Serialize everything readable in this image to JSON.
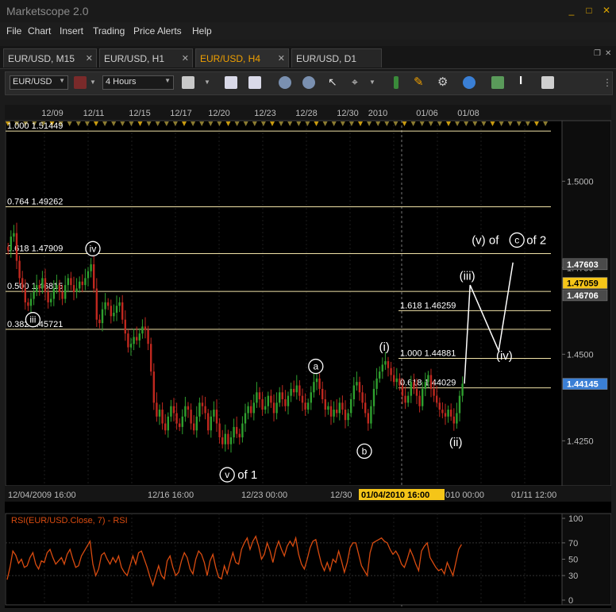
{
  "app": {
    "title": "Marketscope 2.0"
  },
  "window_controls": {
    "min": "_",
    "max": "□",
    "close": "✕"
  },
  "menu": [
    "File",
    "Chart",
    "Insert",
    "Trading",
    "Price Alerts",
    "Help"
  ],
  "tabs": [
    {
      "label": "EUR/USD, M15",
      "active": false
    },
    {
      "label": "EUR/USD, H1",
      "active": false
    },
    {
      "label": "EUR/USD, H4",
      "active": true
    },
    {
      "label": "EUR/USD, D1",
      "active": false
    }
  ],
  "toolbar": {
    "instrument": "EUR/USD",
    "timeframe": "4 Hours",
    "icons": [
      "link-icon",
      "bar-style-icon",
      "data-window-icon",
      "stats-icon",
      "zoom-in-icon",
      "zoom-out-icon",
      "cursor-icon",
      "crosshair-icon",
      "trendline-icon",
      "pencil-icon",
      "gear-icon",
      "globe-icon",
      "indicator-icon",
      "text-icon",
      "table-icon"
    ]
  },
  "colors": {
    "bg": "#000000",
    "panel": "#1b1b1b",
    "up": "#2fa02f",
    "down": "#c0281f",
    "fib": "#f1e3a8",
    "accent": "#f0a000",
    "rsi": "#d84b10",
    "current": "#f5c518",
    "highlight": "#3a7fd5"
  },
  "chart_data": [
    {
      "type": "candlestick",
      "instrument": "EUR/USD",
      "timeframe": "H4",
      "x_date_labels": [
        "12/09",
        "12/11",
        "12/15",
        "12/17",
        "12/20",
        "12/23",
        "12/28",
        "12/30",
        "2010",
        "01/06",
        "01/08"
      ],
      "x_time_labels": [
        "12/04/2009 16:00",
        "12/16 16:00",
        "12/23 00:00",
        "12/30",
        "01/04/2010 16:00",
        "010 00:00",
        "01/11 12:00"
      ],
      "y_ticks": [
        "1.5000",
        "1.4750",
        "1.4500",
        "1.4250"
      ],
      "ylim": [
        1.412,
        1.5175
      ],
      "price_tags": [
        {
          "value": "1.47603",
          "style": "gray"
        },
        {
          "value": "1.47059",
          "style": "current"
        },
        {
          "value": "1.46706",
          "style": "gray"
        },
        {
          "value": "1.44145",
          "style": "highlight"
        }
      ],
      "fib_levels": [
        {
          "label": "1.000 1.51449",
          "price": 1.51449
        },
        {
          "label": "0.764 1.49262",
          "price": 1.49262
        },
        {
          "label": "0.618 1.47909",
          "price": 1.47909
        },
        {
          "label": "0.500 1.46815",
          "price": 1.46815
        },
        {
          "label": "0.382 1.45721",
          "price": 1.45721
        }
      ],
      "ext_levels": [
        {
          "label": "1.618 1.46259",
          "price": 1.46259
        },
        {
          "label": "1.000 1.44881",
          "price": 1.44881
        },
        {
          "label": "0.618 1.44029",
          "price": 1.44029
        }
      ],
      "wave_labels": [
        {
          "circled": "iv",
          "text": "",
          "idx": 30,
          "price": 1.4805
        },
        {
          "circled": "iii",
          "text": "",
          "idx": 9,
          "price": 1.46
        },
        {
          "circled": "v",
          "text": "of 1",
          "idx": 77,
          "price": 1.4152
        },
        {
          "circled": "a",
          "text": "",
          "idx": 108,
          "price": 1.4465
        },
        {
          "circled": "b",
          "text": "",
          "idx": 125,
          "price": 1.422
        },
        {
          "circled": "",
          "text": "(i)",
          "idx": 132,
          "price": 1.451
        },
        {
          "circled": "",
          "text": "(ii)",
          "idx": 157,
          "price": 1.4235
        },
        {
          "circled": "",
          "text": "(iii)",
          "idx": 161,
          "price": 1.4715
        },
        {
          "circled": "",
          "text": "(iv)",
          "idx": 174,
          "price": 1.4485
        },
        {
          "circled": "",
          "text": "(v) of",
          "circled2": "c",
          "text2": "of 2",
          "idx": 177,
          "price": 1.483
        }
      ],
      "projection": [
        [
          160,
          1.4415
        ],
        [
          162,
          1.47
        ],
        [
          172,
          1.451
        ],
        [
          177,
          1.4765
        ]
      ],
      "close": [
        1.48,
        1.484,
        1.485,
        1.477,
        1.472,
        1.469,
        1.465,
        1.464,
        1.466,
        1.468,
        1.47,
        1.469,
        1.472,
        1.468,
        1.465,
        1.466,
        1.469,
        1.47,
        1.468,
        1.466,
        1.47,
        1.472,
        1.47,
        1.468,
        1.469,
        1.471,
        1.47,
        1.472,
        1.474,
        1.476,
        1.469,
        1.46,
        1.459,
        1.463,
        1.465,
        1.464,
        1.461,
        1.462,
        1.464,
        1.465,
        1.46,
        1.456,
        1.452,
        1.453,
        1.455,
        1.454,
        1.456,
        1.458,
        1.457,
        1.453,
        1.445,
        1.436,
        1.432,
        1.434,
        1.43,
        1.428,
        1.432,
        1.435,
        1.433,
        1.43,
        1.429,
        1.432,
        1.435,
        1.434,
        1.43,
        1.428,
        1.432,
        1.436,
        1.435,
        1.433,
        1.428,
        1.432,
        1.434,
        1.43,
        1.426,
        1.424,
        1.427,
        1.424,
        1.426,
        1.429,
        1.427,
        1.426,
        1.43,
        1.433,
        1.435,
        1.433,
        1.436,
        1.439,
        1.437,
        1.434,
        1.435,
        1.438,
        1.436,
        1.433,
        1.436,
        1.439,
        1.437,
        1.435,
        1.438,
        1.44,
        1.439,
        1.441,
        1.438,
        1.436,
        1.434,
        1.436,
        1.439,
        1.442,
        1.443,
        1.44,
        1.437,
        1.434,
        1.435,
        1.432,
        1.434,
        1.433,
        1.436,
        1.434,
        1.431,
        1.433,
        1.437,
        1.441,
        1.442,
        1.439,
        1.436,
        1.433,
        1.43,
        1.435,
        1.44,
        1.443,
        1.445,
        1.447,
        1.448,
        1.446,
        1.444,
        1.442,
        1.443,
        1.441,
        1.438,
        1.436,
        1.438,
        1.442,
        1.44,
        1.438,
        1.435,
        1.44,
        1.442,
        1.444,
        1.44,
        1.438,
        1.436,
        1.434,
        1.433,
        1.432,
        1.434,
        1.432,
        1.43,
        1.433,
        1.438,
        1.4415
      ]
    },
    {
      "type": "line",
      "title": "RSI(EUR/USD.Close, 7) - RSI",
      "y_ticks": [
        "100",
        "70",
        "50",
        "30",
        "0"
      ],
      "ylim": [
        0,
        100
      ],
      "levels": [
        30,
        70
      ],
      "values": [
        25,
        40,
        60,
        55,
        45,
        50,
        40,
        42,
        52,
        58,
        44,
        38,
        48,
        46,
        58,
        62,
        52,
        44,
        48,
        52,
        44,
        56,
        62,
        50,
        40,
        42,
        54,
        60,
        66,
        72,
        44,
        30,
        38,
        55,
        58,
        50,
        44,
        52,
        46,
        54,
        40,
        34,
        30,
        42,
        54,
        44,
        58,
        60,
        50,
        40,
        28,
        18,
        30,
        42,
        30,
        26,
        48,
        54,
        40,
        30,
        34,
        48,
        58,
        52,
        38,
        32,
        50,
        60,
        56,
        46,
        30,
        48,
        56,
        40,
        28,
        26,
        42,
        32,
        46,
        58,
        46,
        44,
        62,
        70,
        76,
        62,
        72,
        78,
        66,
        50,
        56,
        70,
        60,
        46,
        62,
        72,
        62,
        54,
        66,
        72,
        66,
        76,
        56,
        44,
        38,
        50,
        64,
        72,
        74,
        58,
        44,
        36,
        46,
        36,
        50,
        46,
        60,
        48,
        34,
        46,
        64,
        70,
        70,
        56,
        42,
        36,
        30,
        58,
        70,
        72,
        74,
        76,
        72,
        70,
        62,
        56,
        60,
        54,
        44,
        40,
        50,
        62,
        54,
        44,
        36,
        60,
        66,
        70,
        52,
        46,
        40,
        36,
        38,
        32,
        46,
        38,
        30,
        46,
        62,
        68
      ]
    }
  ]
}
